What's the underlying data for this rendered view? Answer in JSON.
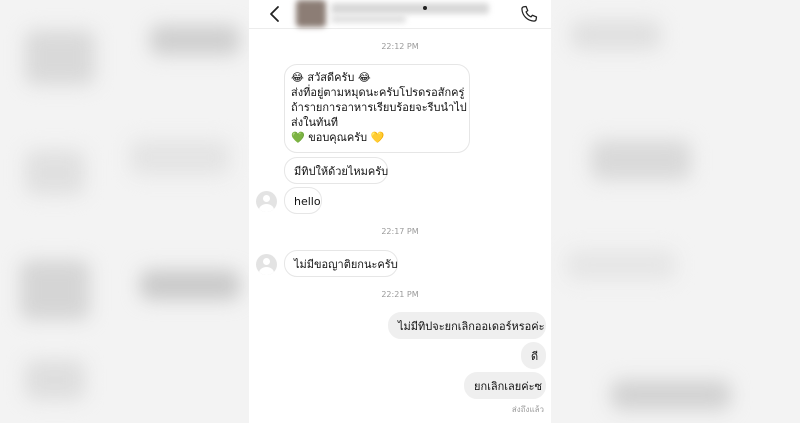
{
  "header": {
    "back_icon": "chevron-left-icon",
    "call_icon": "phone-icon"
  },
  "chat": {
    "timestamps": [
      "22:12 PM",
      "22:17 PM",
      "22:21 PM"
    ],
    "msg1": {
      "lines": [
        "😂 สวัสดีครับ 😂",
        "ส่งที่อยู่ตามหมุดนะครับโปรดรอสักครู่",
        "ถ้ารายการอาหารเรียบร้อยจะรีบนำไป",
        "ส่งในทันที",
        "💚 ขอบคุณครับ 💛"
      ]
    },
    "msg2": "มีทิปให้ด้วยไหมครับ",
    "msg3": "hello",
    "msg4": "ไม่มีขอญาติยกนะครับ",
    "msg5": "ไม่มีทิปจะยกเลิกออเดอร์หรอค่ะ",
    "msg6": "ดี",
    "msg7": "ยกเลิกเลยค่ะซ",
    "status": "ส่งถึงแล้ว"
  },
  "colors": {
    "outgoing_bubble": "#efefef",
    "incoming_border": "#e6e6e6",
    "timestamp": "#9a9a9a"
  }
}
